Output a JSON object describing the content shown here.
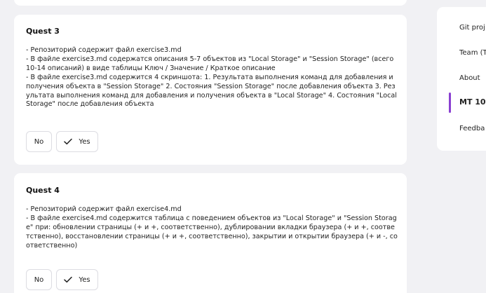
{
  "quests": [
    {
      "title": "Quest 3",
      "description": "- Репозиторий содержит файл exercise3.md\n- В файле exercise3.md содержатся описания 5-7 объектов из \"Local Storage\" и \"Session Storage\" (всего 10-14 описаний) в виде таблицы Ключ / Значение / Краткое описание\n- В файле exercise3.md содержится 4 скриншота:  1. Результата выполнения команд для добавления и получения объекта в \"Session Storage\" 2. Состояния \"Session Storage\" после добавления объекта 3. Результата выполнения команд для добавления и получения объекта в \"Local Storage\" 4. Состояния \"Local Storage\" после добавления объекта",
      "no_label": "No",
      "yes_label": "Yes"
    },
    {
      "title": "Quest 4",
      "description": "- Репозиторий содержит файл exercise4.md\n- В файле exercise4.md содержится таблица с поведением объектов из \"Local Storage\" и \"Session Storage\" при: обновлении страницы (+ и +, соответственно), дублировании вкладки браузера (+ и +, соответственно), восстановлении страницы (+ и +, соответственно), закрытии и открытии браузера (+ и -, соответственно)",
      "no_label": "No",
      "yes_label": "Yes"
    }
  ],
  "sidebar": {
    "items": [
      {
        "label": "Git proj",
        "active": false
      },
      {
        "label": "Team (T",
        "active": false
      },
      {
        "label": "About",
        "active": false
      },
      {
        "label": "MT 10",
        "active": true
      },
      {
        "label": "Feedba",
        "active": false
      }
    ],
    "accent_color": "#8a3fd1"
  },
  "icons": {
    "yes": "check-icon"
  }
}
